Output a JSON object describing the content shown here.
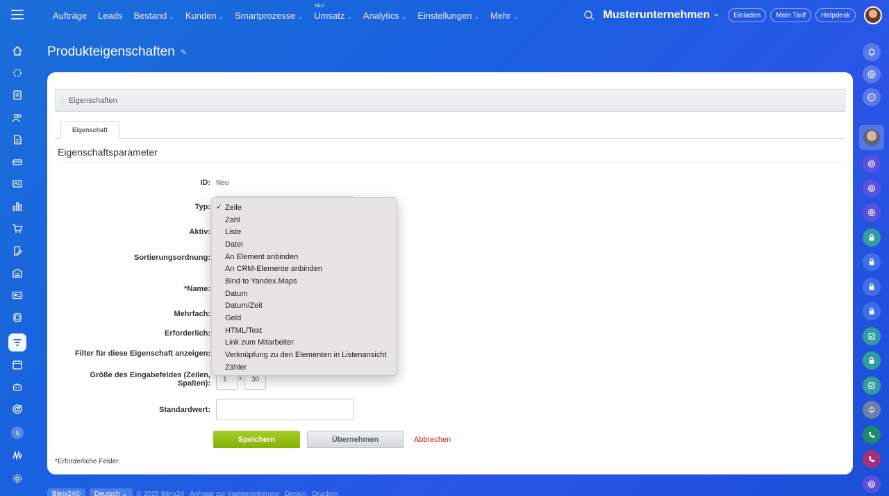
{
  "nav": {
    "items": [
      {
        "label": "Aufträge",
        "chevron": false
      },
      {
        "label": "Leads",
        "chevron": false
      },
      {
        "label": "Bestand",
        "chevron": true
      },
      {
        "label": "Kunden",
        "chevron": true
      },
      {
        "label": "Smartprozesse",
        "chevron": true
      },
      {
        "label": "Umsatz",
        "chevron": true,
        "badge": "NEU"
      },
      {
        "label": "Analytics",
        "chevron": true
      },
      {
        "label": "Einstellungen",
        "chevron": true
      },
      {
        "label": "Mehr",
        "chevron": true
      }
    ],
    "company": "Musterunternehmen",
    "buttons": [
      "Einladen",
      "Mein Tarif",
      "Helpdesk"
    ]
  },
  "page": {
    "title": "Produkteigenschaften"
  },
  "section": {
    "title": "Eigenschaften",
    "tab": "Eigenschaft",
    "params_title": "Eigenschaftsparameter"
  },
  "form": {
    "id_label": "ID:",
    "id_value": "Neu",
    "type_label": "Typ:",
    "active_label": "Aktiv:",
    "sort_label": "Sortierungsordnung:",
    "name_label": "Name:",
    "name_required": "*",
    "multiple_label": "Mehrfach:",
    "required_label": "Erforderlich:",
    "filter_label": "Filter für diese Eigenschaft anzeigen:",
    "size_label_1": "Größe des Eingabefeldes (Zeilen,",
    "size_label_2": "Spalten):",
    "size_rows": "1",
    "size_x": "x",
    "size_cols": "30",
    "default_label": "Standardwert:",
    "default_value": ""
  },
  "buttons": {
    "save": "Speichern",
    "apply": "Übernehmen",
    "cancel": "Abbrechen"
  },
  "required_note": {
    "star": "*",
    "text": "Erforderliche Felder."
  },
  "type_dropdown": {
    "selected": "Zeile",
    "check": "✓",
    "options": [
      "Zeile",
      "Zahl",
      "Liste",
      "Datei",
      "An Element anbinden",
      "An CRM-Elemente anbinden",
      "Bind to Yandex.Maps",
      "Datum",
      "Datum/Zeit",
      "Geld",
      "HTML/Text",
      "Link zum Mitarbeiter",
      "Verknüpfung zu den Elementen in Listenansicht",
      "Zähler"
    ]
  },
  "footer": {
    "brand": "Bitrix24©",
    "language": "Deutsch ⌄",
    "copyright": "© 2025 Bitrix24",
    "links": [
      "Anfrage zur Implementierung",
      "Design",
      "Drucken"
    ]
  },
  "sidebar_badge": "S",
  "colors": {
    "accent_green": "#86b100",
    "cancel_red": "#d3141b",
    "background_blue": "#1a5fe0"
  },
  "icons": {
    "left": [
      "home-icon",
      "sparkle-icon",
      "tasks-icon",
      "contacts-icon",
      "document-icon",
      "cash-icon",
      "presentation-icon",
      "chart-icon",
      "cart-icon",
      "edit-doc-icon",
      "warehouse-icon",
      "id-card-icon",
      "box-icon",
      "filter-icon",
      "calendar-icon",
      "robot-icon",
      "target-icon",
      "user-badge-icon",
      "brand-icon",
      "gear-icon"
    ],
    "right": [
      "bell-icon",
      "spiral-icon",
      "chat-search-icon",
      "avatar-icon",
      "spiral-icon",
      "spiral-icon",
      "spiral-icon",
      "lock-icon",
      "lock-icon",
      "lock-icon",
      "lock-icon",
      "checkbox-icon",
      "lock-icon",
      "checkbox-icon",
      "bot-icon",
      "phone-icon",
      "phone-icon",
      "spiral-icon"
    ]
  }
}
